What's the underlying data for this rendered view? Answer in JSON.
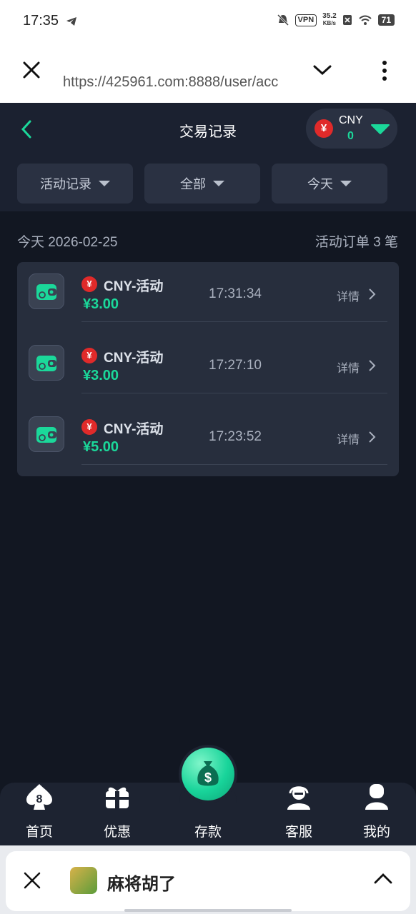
{
  "status_bar": {
    "time": "17:35",
    "vpn": "VPN",
    "speed_value": "35.2",
    "speed_unit": "KB/s",
    "battery": "71"
  },
  "browser": {
    "url": "https://425961.com:8888/user/acc"
  },
  "header": {
    "title": "交易记录",
    "currency": {
      "code": "CNY",
      "balance": "0",
      "symbol": "¥"
    },
    "filters": [
      "活动记录",
      "全部",
      "今天"
    ]
  },
  "summary": {
    "date": "今天 2026-02-25",
    "count": "活动订单 3 笔"
  },
  "records": [
    {
      "title": "CNY-活动",
      "amount": "¥3.00",
      "time": "17:31:34",
      "detail": "详情",
      "symbol": "¥"
    },
    {
      "title": "CNY-活动",
      "amount": "¥3.00",
      "time": "17:27:10",
      "detail": "详情",
      "symbol": "¥"
    },
    {
      "title": "CNY-活动",
      "amount": "¥5.00",
      "time": "17:23:52",
      "detail": "详情",
      "symbol": "¥"
    }
  ],
  "nav": {
    "home": "首页",
    "promo": "优惠",
    "deposit": "存款",
    "service": "客服",
    "mine": "我的"
  },
  "banner": {
    "app_name": "麻将胡了"
  },
  "colors": {
    "accent": "#1bd89a",
    "background": "#121722",
    "card": "#272e3d",
    "badge_red": "#e02a2a"
  }
}
